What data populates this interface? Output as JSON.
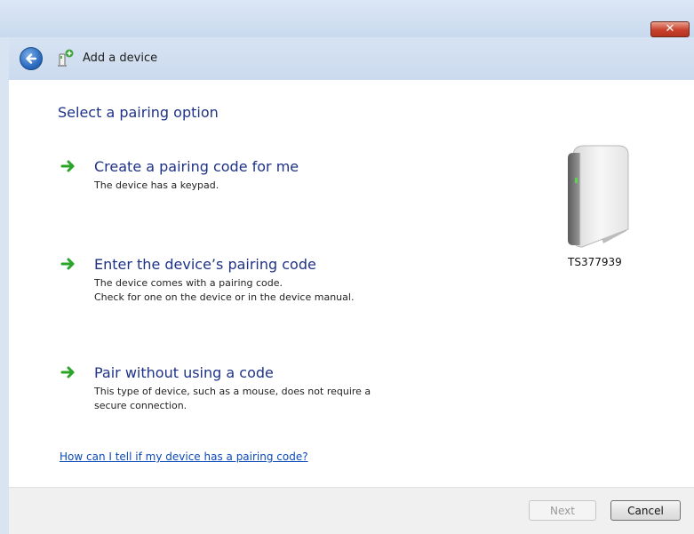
{
  "window": {
    "close_label": "✕",
    "title": "Add a device"
  },
  "main": {
    "heading": "Select a pairing option",
    "options": [
      {
        "title": "Create a pairing code for me",
        "description_lines": [
          "The device has a keypad."
        ]
      },
      {
        "title": "Enter the device’s pairing code",
        "description_lines": [
          "The device comes with a pairing code.",
          "Check for one on the device or in the device manual."
        ]
      },
      {
        "title": "Pair without using a code",
        "description_lines": [
          "This type of device, such as a mouse, does not require a",
          "secure connection."
        ]
      }
    ],
    "help_link": "How can I tell if my device has a pairing code?"
  },
  "device": {
    "name": "TS377939",
    "icon": "external-drive-icon"
  },
  "footer": {
    "next_label": "Next",
    "next_enabled": false,
    "cancel_label": "Cancel"
  },
  "colors": {
    "heading": "#1e3287",
    "link": "#0a4ab8",
    "arrow": "#2aa52a",
    "close": "#c8402a"
  }
}
